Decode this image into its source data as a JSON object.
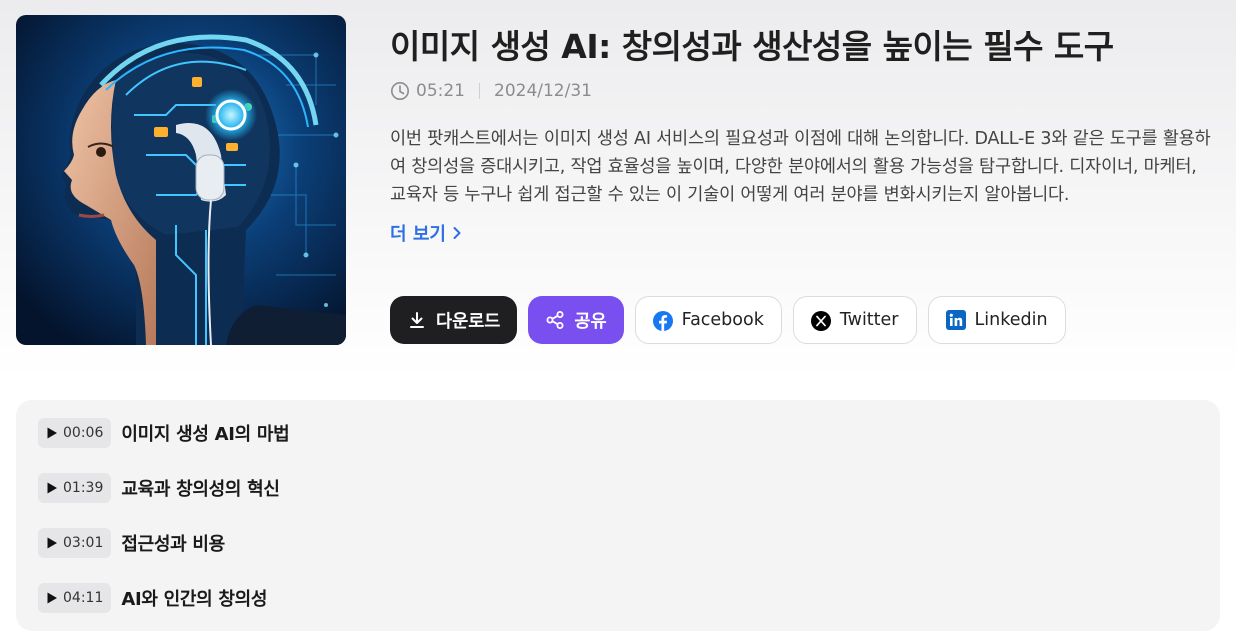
{
  "episode": {
    "title": "이미지 생성 AI: 창의성과 생산성을 높이는 필수 도구",
    "duration": "05:21",
    "date": "2024/12/31",
    "description": "이번 팟캐스트에서는 이미지 생성 AI 서비스의 필요성과 이점에 대해 논의합니다. DALL-E 3와 같은 도구를 활용하여 창의성을 증대시키고, 작업 효율성을 높이며, 다양한 분야에서의 활용 가능성을 탐구합니다. 디자이너, 마케터, 교육자 등 누구나 쉽게 접근할 수 있는 이 기술이 어떻게 여러 분야를 변화시키는지 알아봅니다.",
    "more_label": "더 보기"
  },
  "actions": {
    "download": "다운로드",
    "share": "공유",
    "facebook": "Facebook",
    "twitter": "Twitter",
    "linkedin": "Linkedin"
  },
  "chapters": [
    {
      "time": "00:06",
      "title": "이미지 생성 AI의 마법"
    },
    {
      "time": "01:39",
      "title": "교육과 창의성의 혁신"
    },
    {
      "time": "03:01",
      "title": "접근성과 비용"
    },
    {
      "time": "04:11",
      "title": "AI와 인간의 창의성"
    }
  ],
  "colors": {
    "accent_blue": "#2f6fe6",
    "share_purple": "#7a4ff0",
    "download_dark": "#1f1f22",
    "facebook_blue": "#1877f2",
    "linkedin_blue": "#0a66c2"
  },
  "icons": {
    "meta": "clock-icon",
    "more": "chevron-right-icon",
    "download": "download-icon",
    "share": "share-icon",
    "facebook": "facebook-icon",
    "twitter": "x-icon",
    "linkedin": "linkedin-icon",
    "chapter": "play-icon"
  }
}
